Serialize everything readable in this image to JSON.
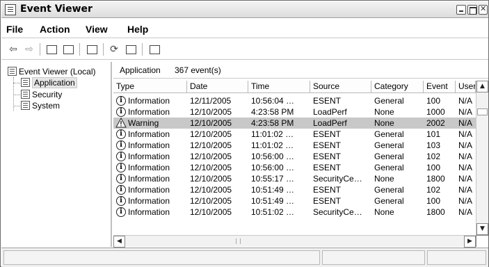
{
  "window": {
    "title": "Event Viewer"
  },
  "menu": {
    "items": [
      "File",
      "Action",
      "View",
      "Help"
    ]
  },
  "toolbar": {
    "icons": [
      "back-arrow-icon",
      "forward-arrow-icon",
      "up-folder-icon",
      "show-hide-tree-icon",
      "properties-icon",
      "refresh-icon",
      "export-list-icon",
      "help-icon"
    ]
  },
  "tree": {
    "root": "Event Viewer (Local)",
    "children": [
      "Application",
      "Security",
      "System"
    ],
    "selected": "Application"
  },
  "list": {
    "header_name": "Application",
    "header_count": "367 event(s)",
    "columns": [
      "Type",
      "Date",
      "Time",
      "Source",
      "Category",
      "Event",
      "User"
    ],
    "rows": [
      {
        "type": "Information",
        "date": "12/11/2005",
        "time": "10:56:04 …",
        "source": "ESENT",
        "category": "General",
        "event": "100",
        "user": "N/A"
      },
      {
        "type": "Information",
        "date": "12/10/2005",
        "time": "4:23:58 PM",
        "source": "LoadPerf",
        "category": "None",
        "event": "1000",
        "user": "N/A"
      },
      {
        "type": "Warning",
        "date": "12/10/2005",
        "time": "4:23:58 PM",
        "source": "LoadPerf",
        "category": "None",
        "event": "2002",
        "user": "N/A"
      },
      {
        "type": "Information",
        "date": "12/10/2005",
        "time": "11:01:02 …",
        "source": "ESENT",
        "category": "General",
        "event": "101",
        "user": "N/A"
      },
      {
        "type": "Information",
        "date": "12/10/2005",
        "time": "11:01:02 …",
        "source": "ESENT",
        "category": "General",
        "event": "103",
        "user": "N/A"
      },
      {
        "type": "Information",
        "date": "12/10/2005",
        "time": "10:56:00 …",
        "source": "ESENT",
        "category": "General",
        "event": "102",
        "user": "N/A"
      },
      {
        "type": "Information",
        "date": "12/10/2005",
        "time": "10:56:00 …",
        "source": "ESENT",
        "category": "General",
        "event": "100",
        "user": "N/A"
      },
      {
        "type": "Information",
        "date": "12/10/2005",
        "time": "10:55:17 …",
        "source": "SecurityCe…",
        "category": "None",
        "event": "1800",
        "user": "N/A"
      },
      {
        "type": "Information",
        "date": "12/10/2005",
        "time": "10:51:49 …",
        "source": "ESENT",
        "category": "General",
        "event": "102",
        "user": "N/A"
      },
      {
        "type": "Information",
        "date": "12/10/2005",
        "time": "10:51:49 …",
        "source": "ESENT",
        "category": "General",
        "event": "100",
        "user": "N/A"
      },
      {
        "type": "Information",
        "date": "12/10/2005",
        "time": "10:51:02 …",
        "source": "SecurityCe…",
        "category": "None",
        "event": "1800",
        "user": "N/A"
      }
    ],
    "selected_row": 2
  },
  "colors": {
    "selection": "#c8c8c8",
    "border": "#6a6a6a"
  }
}
